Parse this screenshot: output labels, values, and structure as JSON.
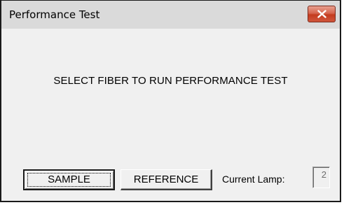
{
  "window": {
    "title": "Performance Test",
    "close_icon": "close-icon"
  },
  "content": {
    "message": "SELECT FIBER TO RUN PERFORMANCE TEST"
  },
  "buttons": {
    "sample_label": "SAMPLE",
    "reference_label": "REFERENCE"
  },
  "lamp": {
    "label": "Current Lamp:",
    "value": "2"
  },
  "colors": {
    "close_button": "#c43c1f",
    "titlebar": "#dadada",
    "client_background": "#f0f0f0"
  }
}
